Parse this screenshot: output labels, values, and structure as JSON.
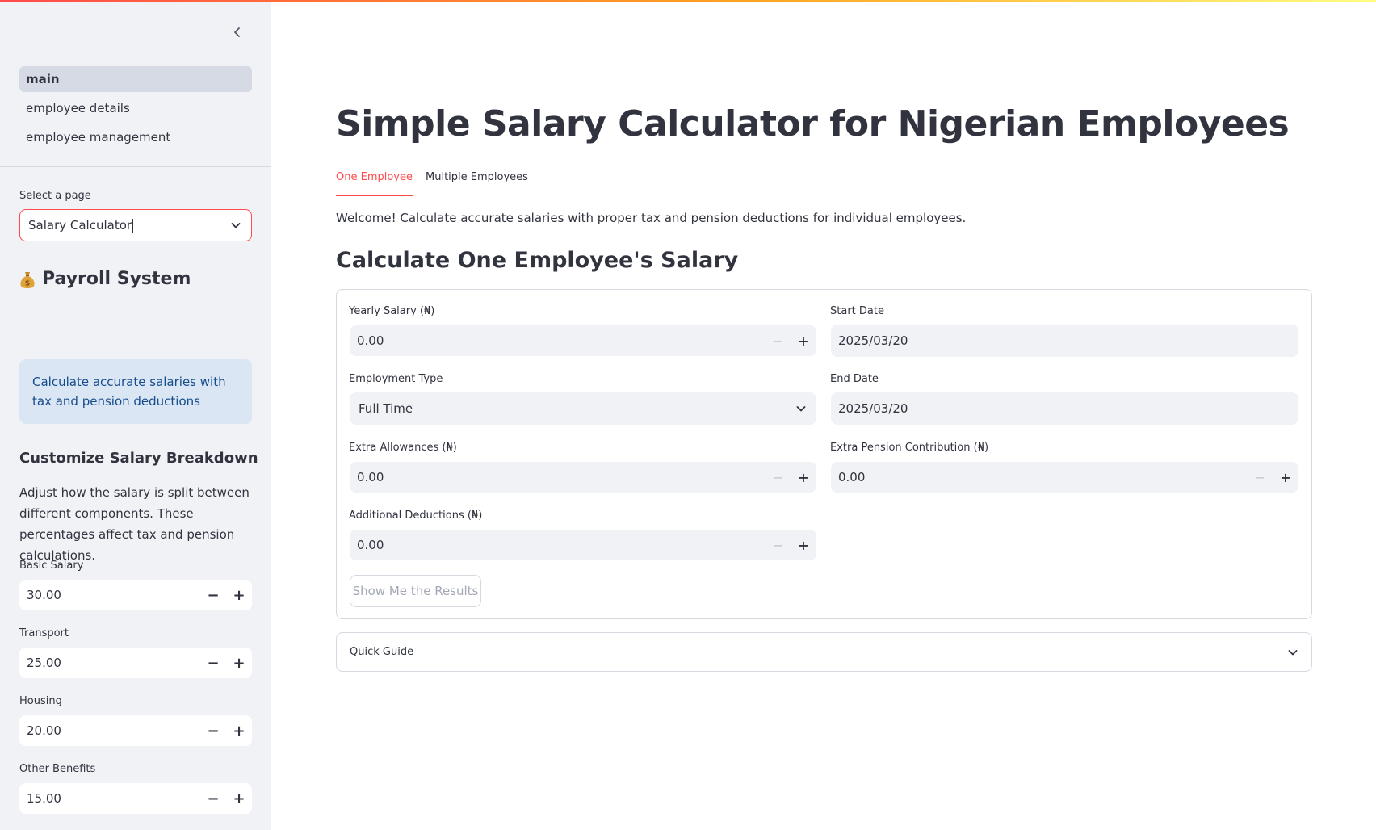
{
  "sidebar": {
    "nav": [
      {
        "label": "main"
      },
      {
        "label": "employee details"
      },
      {
        "label": "employee management"
      }
    ],
    "select_label": "Select a page",
    "select_value": "Salary Calculator",
    "app_title": "Payroll System",
    "info": "Calculate accurate salaries with tax and pension deductions",
    "customize_heading": "Customize Salary Breakdown",
    "customize_text": "Adjust how the salary is split between different components. These percentages affect tax and pension calculations.",
    "fields": [
      {
        "label": "Basic Salary",
        "value": "30.00"
      },
      {
        "label": "Transport",
        "value": "25.00"
      },
      {
        "label": "Housing",
        "value": "20.00"
      },
      {
        "label": "Other Benefits",
        "value": "15.00"
      }
    ]
  },
  "main": {
    "title": "Simple Salary Calculator for Nigerian Employees",
    "tabs": [
      {
        "label": "One Employee"
      },
      {
        "label": "Multiple Employees"
      }
    ],
    "welcome": "Welcome! Calculate accurate salaries with proper tax and pension deductions for individual employees.",
    "section_heading": "Calculate One Employee's Salary",
    "form": {
      "yearly_salary": {
        "label": "Yearly Salary (₦)",
        "value": "0.00"
      },
      "start_date": {
        "label": "Start Date",
        "value": "2025/03/20"
      },
      "employment_type": {
        "label": "Employment Type",
        "value": "Full Time"
      },
      "end_date": {
        "label": "End Date",
        "value": "2025/03/20"
      },
      "extra_allowances": {
        "label": "Extra Allowances (₦)",
        "value": "0.00"
      },
      "extra_pension": {
        "label": "Extra Pension Contribution (₦)",
        "value": "0.00"
      },
      "additional_deductions": {
        "label": "Additional Deductions (₦)",
        "value": "0.00"
      },
      "submit_label": "Show Me the Results"
    },
    "guide_label": "Quick Guide"
  },
  "colors": {
    "accent": "#ff4b4b",
    "sidebar_bg": "#f0f2f6",
    "info_bg": "#dbe6f4",
    "info_text": "#154c8b"
  },
  "icons": {
    "collapse": "chevron-left-icon",
    "dropdown": "chevron-down-icon",
    "app": "money-bag-icon"
  }
}
